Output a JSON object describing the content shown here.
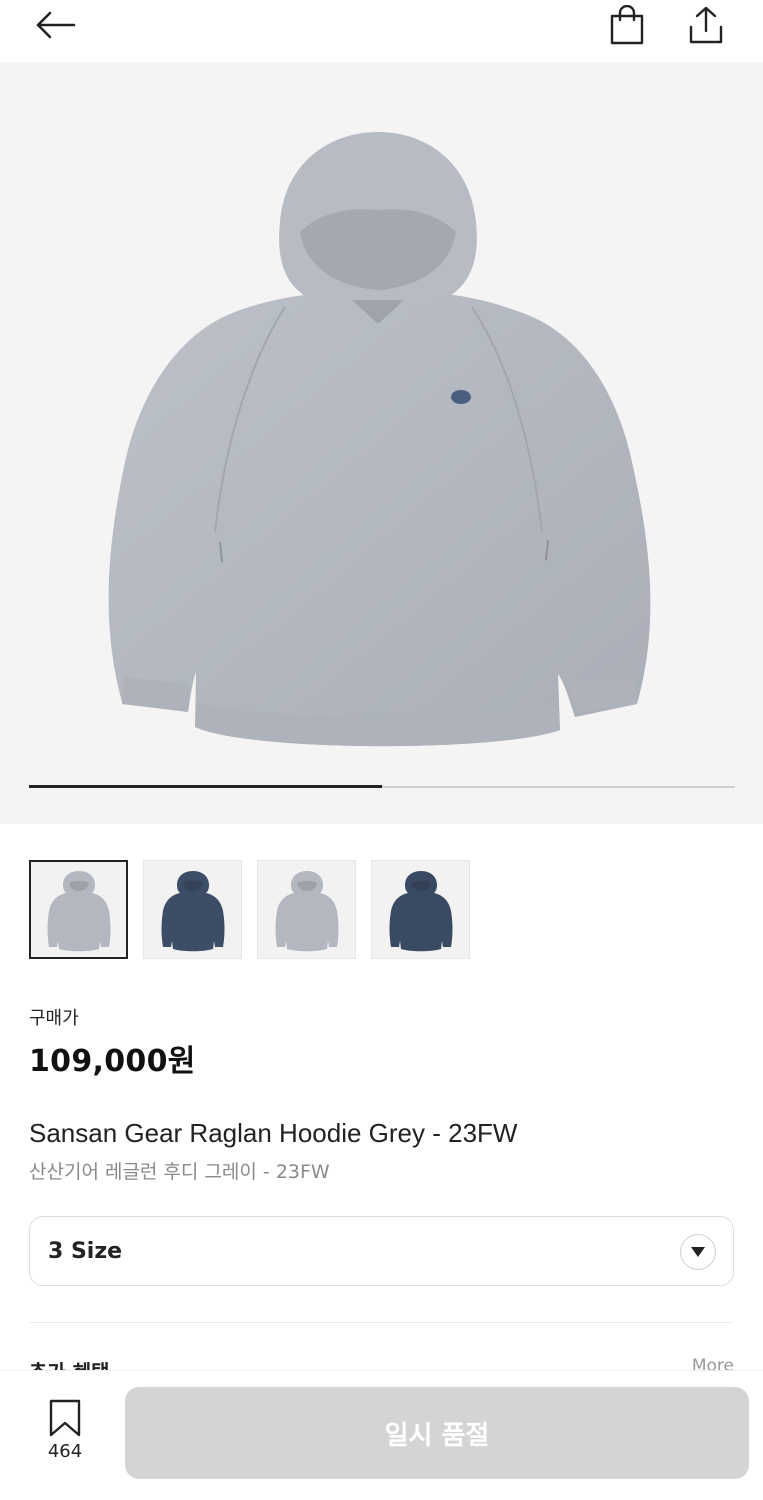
{
  "header": {
    "back_icon": "arrow-left-icon",
    "bag_icon": "shopping-bag-icon",
    "share_icon": "share-upload-icon"
  },
  "gallery": {
    "progress": 0.5,
    "thumbnails": [
      {
        "name": "grey",
        "color": "#b3b8c0",
        "selected": true
      },
      {
        "name": "navy",
        "color": "#3d4d66",
        "selected": false
      },
      {
        "name": "grey",
        "color": "#b3b8c0",
        "selected": false
      },
      {
        "name": "navy",
        "color": "#3b4a63",
        "selected": false
      }
    ]
  },
  "product": {
    "price_label": "구매가",
    "price": "109,000원",
    "title_en": "Sansan Gear Raglan Hoodie Grey - 23FW",
    "title_ko": "산산기어 레글런 후디 그레이 - 23FW"
  },
  "size_select": {
    "label": "3 Size",
    "icon": "chevron-down-icon"
  },
  "next_section": {
    "title": "추가 혜택",
    "more": "More"
  },
  "bottom_bar": {
    "wish_count": "464",
    "buy_label": "일시 품절"
  },
  "colors": {
    "hoodie_grey": "#b3b8c0",
    "hoodie_navy": "#3d4d66",
    "disabled_button": "#d4d4d4"
  }
}
